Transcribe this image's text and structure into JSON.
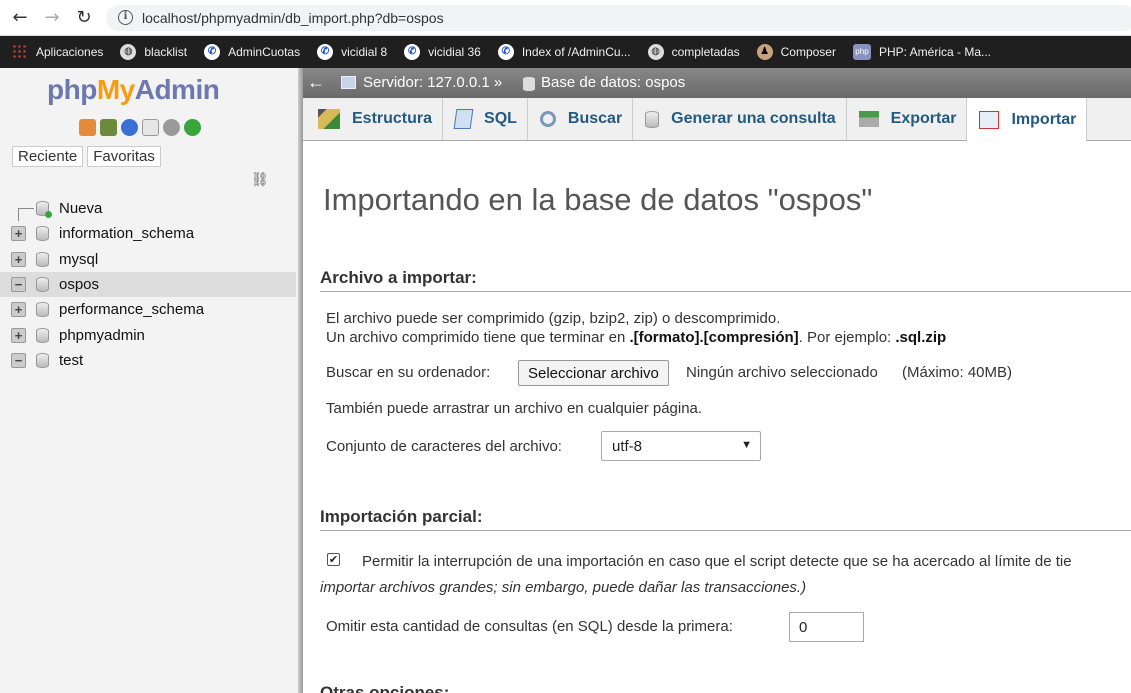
{
  "browser": {
    "url": "localhost/phpmyadmin/db_import.php?db=ospos",
    "back_icon": "←",
    "forward_icon": "→",
    "reload_icon": "↻",
    "info_icon": "i",
    "bookmarks": [
      {
        "label": "Aplicaciones",
        "icon": "apps-icon"
      },
      {
        "label": "blacklist",
        "icon": "globe-icon"
      },
      {
        "label": "AdminCuotas",
        "icon": "phone-icon"
      },
      {
        "label": "vicidial 8",
        "icon": "phone-icon"
      },
      {
        "label": "vicidial 36",
        "icon": "phone-icon"
      },
      {
        "label": "Index of /AdminCu...",
        "icon": "phone-icon"
      },
      {
        "label": "completadas",
        "icon": "globe-icon"
      },
      {
        "label": "Composer",
        "icon": "composer-icon"
      },
      {
        "label": "PHP: América - Ma...",
        "icon": "php-icon"
      }
    ]
  },
  "sidebar": {
    "logo_php": "php",
    "logo_my": "My",
    "logo_admin": "Admin",
    "tabs": [
      "Reciente",
      "Favoritas"
    ],
    "link_icon": "⛓",
    "databases": [
      {
        "label": "Nueva",
        "expander": "",
        "is_new": true
      },
      {
        "label": "information_schema",
        "expander": "+"
      },
      {
        "label": "mysql",
        "expander": "+"
      },
      {
        "label": "ospos",
        "expander": "−",
        "active": true
      },
      {
        "label": "performance_schema",
        "expander": "+"
      },
      {
        "label": "phpmyadmin",
        "expander": "+"
      },
      {
        "label": "test",
        "expander": "−"
      }
    ]
  },
  "breadcrumb": {
    "back": "←",
    "server": "Servidor: 127.0.0.1 »",
    "database": "Base de datos: ospos"
  },
  "tabs": [
    {
      "label": "Estructura",
      "icon": "structure-icon"
    },
    {
      "label": "SQL",
      "icon": "sql-icon"
    },
    {
      "label": "Buscar",
      "icon": "search-icon"
    },
    {
      "label": "Generar una consulta",
      "icon": "query-icon"
    },
    {
      "label": "Exportar",
      "icon": "export-icon"
    },
    {
      "label": "Importar",
      "icon": "import-icon",
      "active": true
    }
  ],
  "main": {
    "title": "Importando en la base de datos \"ospos\"",
    "file_section": {
      "heading": "Archivo a importar:",
      "line1": "El archivo puede ser comprimido (gzip, bzip2, zip) o descomprimido.",
      "line2_prefix": "Un archivo comprimido tiene que terminar en ",
      "line2_format": ".[formato].[compresión]",
      "line2_mid": ". Por ejemplo: ",
      "line2_example": ".sql.zip",
      "browse_label": "Buscar en su ordenador:",
      "browse_button": "Seleccionar archivo",
      "no_file": "Ningún archivo seleccionado",
      "max_size": "(Máximo: 40MB)",
      "drag_hint": "También puede arrastrar un archivo en cualquier página.",
      "charset_label": "Conjunto de caracteres del archivo:",
      "charset_value": "utf-8"
    },
    "partial_section": {
      "heading": "Importación parcial:",
      "allow_interrupt": "Permitir la interrupción de una importación en caso que el script detecte que se ha acercado al límite de tie",
      "allow_interrupt_note": "importar archivos grandes; sin embargo, puede dañar las transacciones.)",
      "checkbox_checked": true,
      "skip_label": "Omitir esta cantidad de consultas (en SQL) desde la primera:",
      "skip_value": "0"
    },
    "next_section_heading": "Otras opciones:"
  }
}
